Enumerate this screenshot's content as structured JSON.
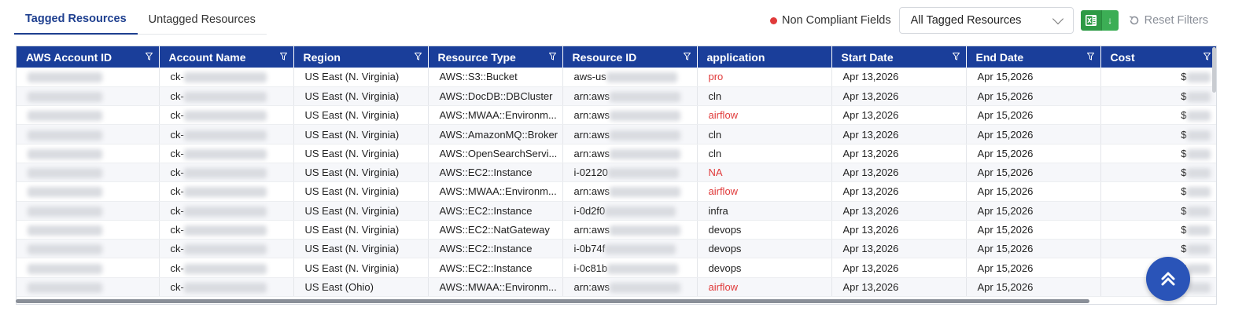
{
  "tabs": [
    {
      "label": "Tagged Resources",
      "active": true
    },
    {
      "label": "Untagged Resources",
      "active": false
    }
  ],
  "toolbar": {
    "non_compliant_label": "Non Compliant Fields",
    "filter_select_value": "All Tagged Resources",
    "reset_label": "Reset Filters"
  },
  "colors": {
    "header_bg": "#1a3e9a",
    "accent": "#1e3f8f",
    "non_compliant": "#e03a3a",
    "excel_green": "#2e9a45"
  },
  "columns": [
    "AWS Account ID",
    "Account Name",
    "Region",
    "Resource Type",
    "Resource ID",
    "application",
    "Start Date",
    "End Date",
    "Cost"
  ],
  "rows": [
    {
      "account_name": "ck-",
      "region": "US East (N. Virginia)",
      "resource_type": "AWS::S3::Bucket",
      "resource_id": "aws-us",
      "application": "pro",
      "non_compliant": true,
      "start_date": "Apr 13,2026",
      "end_date": "Apr 15,2026",
      "cost": "$"
    },
    {
      "account_name": "ck-",
      "region": "US East (N. Virginia)",
      "resource_type": "AWS::DocDB::DBCluster",
      "resource_id": "arn:aws",
      "application": "cln",
      "non_compliant": false,
      "start_date": "Apr 13,2026",
      "end_date": "Apr 15,2026",
      "cost": "$"
    },
    {
      "account_name": "ck-",
      "region": "US East (N. Virginia)",
      "resource_type": "AWS::MWAA::Environm...",
      "resource_id": "arn:aws",
      "application": "airflow",
      "non_compliant": true,
      "start_date": "Apr 13,2026",
      "end_date": "Apr 15,2026",
      "cost": "$"
    },
    {
      "account_name": "ck-",
      "region": "US East (N. Virginia)",
      "resource_type": "AWS::AmazonMQ::Broker",
      "resource_id": "arn:aws",
      "application": "cln",
      "non_compliant": false,
      "start_date": "Apr 13,2026",
      "end_date": "Apr 15,2026",
      "cost": "$"
    },
    {
      "account_name": "ck-",
      "region": "US East (N. Virginia)",
      "resource_type": "AWS::OpenSearchServi...",
      "resource_id": "arn:aws",
      "application": "cln",
      "non_compliant": false,
      "start_date": "Apr 13,2026",
      "end_date": "Apr 15,2026",
      "cost": "$"
    },
    {
      "account_name": "ck-",
      "region": "US East (N. Virginia)",
      "resource_type": "AWS::EC2::Instance",
      "resource_id": "i-02120",
      "application": "NA",
      "non_compliant": true,
      "start_date": "Apr 13,2026",
      "end_date": "Apr 15,2026",
      "cost": "$"
    },
    {
      "account_name": "ck-",
      "region": "US East (N. Virginia)",
      "resource_type": "AWS::MWAA::Environm...",
      "resource_id": "arn:aws",
      "application": "airflow",
      "non_compliant": true,
      "start_date": "Apr 13,2026",
      "end_date": "Apr 15,2026",
      "cost": "$"
    },
    {
      "account_name": "ck-",
      "region": "US East (N. Virginia)",
      "resource_type": "AWS::EC2::Instance",
      "resource_id": "i-0d2f0",
      "application": "infra",
      "non_compliant": false,
      "start_date": "Apr 13,2026",
      "end_date": "Apr 15,2026",
      "cost": "$"
    },
    {
      "account_name": "ck-",
      "region": "US East (N. Virginia)",
      "resource_type": "AWS::EC2::NatGateway",
      "resource_id": "arn:aws",
      "application": "devops",
      "non_compliant": false,
      "start_date": "Apr 13,2026",
      "end_date": "Apr 15,2026",
      "cost": "$"
    },
    {
      "account_name": "ck-",
      "region": "US East (N. Virginia)",
      "resource_type": "AWS::EC2::Instance",
      "resource_id": "i-0b74f",
      "application": "devops",
      "non_compliant": false,
      "start_date": "Apr 13,2026",
      "end_date": "Apr 15,2026",
      "cost": "$"
    },
    {
      "account_name": "ck-",
      "region": "US East (N. Virginia)",
      "resource_type": "AWS::EC2::Instance",
      "resource_id": "i-0c81b",
      "application": "devops",
      "non_compliant": false,
      "start_date": "Apr 13,2026",
      "end_date": "Apr 15,2026",
      "cost": "$"
    },
    {
      "account_name": "ck-",
      "region": "US East (Ohio)",
      "resource_type": "AWS::MWAA::Environm...",
      "resource_id": "arn:aws",
      "application": "airflow",
      "non_compliant": true,
      "start_date": "Apr 13,2026",
      "end_date": "Apr 15,2026",
      "cost": "$"
    }
  ],
  "icons": {
    "column_filter": "filter-icon",
    "excel": "excel-icon",
    "download": "download-arrow-icon",
    "reset": "reset-icon",
    "scroll_top": "double-chevron-up-icon"
  }
}
